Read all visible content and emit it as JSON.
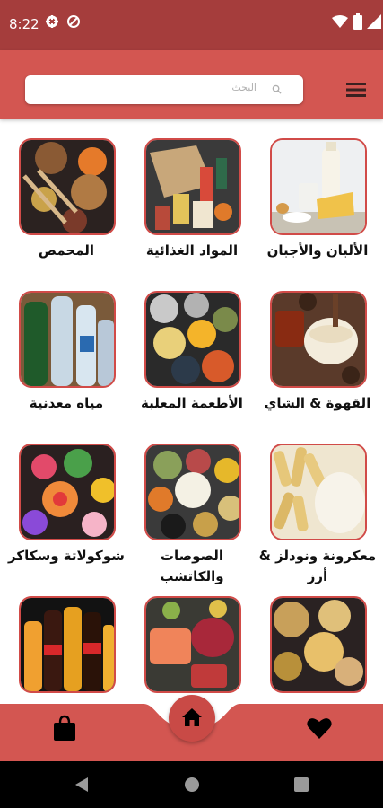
{
  "status_bar": {
    "time": "8:22"
  },
  "search": {
    "placeholder": "البحث"
  },
  "categories": [
    {
      "label": "الألبان والأجبان",
      "image": "dairy"
    },
    {
      "label": "المواد الغذائية",
      "image": "groceries"
    },
    {
      "label": "المحمص",
      "image": "roastery"
    },
    {
      "label": "القهوة & الشاي",
      "image": "coffee-tea"
    },
    {
      "label": "الأطعمة المعلبة",
      "image": "canned"
    },
    {
      "label": "مياه معدنية",
      "image": "water"
    },
    {
      "label": "معكرونة ونودلز & أرز",
      "image": "pasta"
    },
    {
      "label": "الصوصات والكاتشب",
      "image": "sauces"
    },
    {
      "label": "شوكولاتة وسكاكر",
      "image": "sweets"
    },
    {
      "label": "",
      "image": "snacks"
    },
    {
      "label": "",
      "image": "meat"
    },
    {
      "label": "",
      "image": "drinks"
    }
  ],
  "bottom_nav": {
    "left": "bag-icon",
    "center": "home-icon",
    "right": "heart-icon"
  },
  "colors": {
    "status_bar": "#a53d3c",
    "app_bar": "#d35651",
    "accent": "#d14b48",
    "nav": "#d35651"
  }
}
